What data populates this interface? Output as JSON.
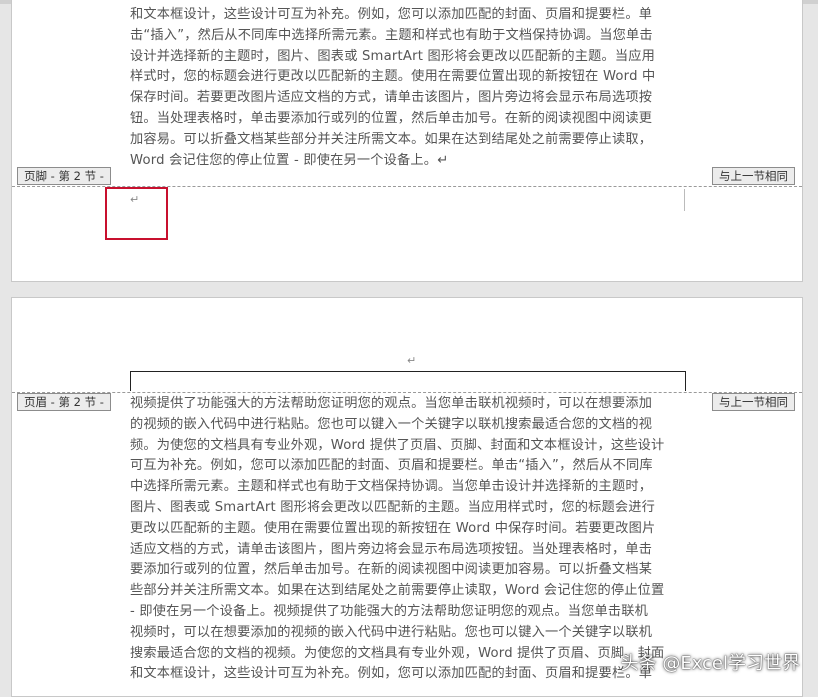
{
  "page1": {
    "body_lines": [
      "和文本框设计，这些设计可互为补充。例如，您可以添加匹配的封面、页眉和提要栏。单",
      "击“插入”，然后从不同库中选择所需元素。主题和样式也有助于文档保持协调。当您单击",
      "设计并选择新的主题时，图片、图表或 SmartArt 图形将会更改以匹配新的主题。当应用",
      "样式时，您的标题会进行更改以匹配新的主题。使用在需要位置出现的新按钮在 Word 中",
      "保存时间。若要更改图片适应文档的方式，请单击该图片，图片旁边将会显示布局选项按",
      "钮。当处理表格时，单击要添加行或列的位置，然后单击加号。在新的阅读视图中阅读更",
      "加容易。可以折叠文档某些部分并关注所需文本。如果在达到结尾处之前需要停止读取，",
      "Word 会记住您的停止位置 - 即使在另一个设备上。↵"
    ],
    "footer_tag": "页脚 - 第 2 节 -",
    "same_as_prev_tag": "与上一节相同",
    "footer_para_mark": "↵"
  },
  "page2": {
    "header_para_mark": "↵",
    "header_tag": "页眉 - 第 2 节 -",
    "same_as_prev_tag": "与上一节相同",
    "body_lines": [
      "视频提供了功能强大的方法帮助您证明您的观点。当您单击联机视频时，可以在想要添加",
      "的视频的嵌入代码中进行粘贴。您也可以键入一个关键字以联机搜索最适合您的文档的视",
      "频。为使您的文档具有专业外观，Word 提供了页眉、页脚、封面和文本框设计，这些设计",
      "可互为补充。例如，您可以添加匹配的封面、页眉和提要栏。单击“插入”，然后从不同库",
      "中选择所需元素。主题和样式也有助于文档保持协调。当您单击设计并选择新的主题时，",
      "图片、图表或 SmartArt 图形将会更改以匹配新的主题。当应用样式时，您的标题会进行",
      "更改以匹配新的主题。使用在需要位置出现的新按钮在 Word 中保存时间。若要更改图片",
      "适应文档的方式，请单击该图片，图片旁边将会显示布局选项按钮。当处理表格时，单击",
      "要添加行或列的位置，然后单击加号。在新的阅读视图中阅读更加容易。可以折叠文档某",
      "些部分并关注所需文本。如果在达到结尾处之前需要停止读取，Word 会记住您的停止位置",
      "- 即使在另一个设备上。视频提供了功能强大的方法帮助您证明您的观点。当您单击联机",
      "视频时，可以在想要添加的视频的嵌入代码中进行粘贴。您也可以键入一个关键字以联机",
      "搜索最适合您的文档的视频。为使您的文档具有专业外观，Word 提供了页眉、页脚、封面",
      "和文本框设计，这些设计可互为补充。例如，您可以添加匹配的封面、页眉和提要栏。单"
    ]
  },
  "watermark": "头条 @Excel学习世界"
}
